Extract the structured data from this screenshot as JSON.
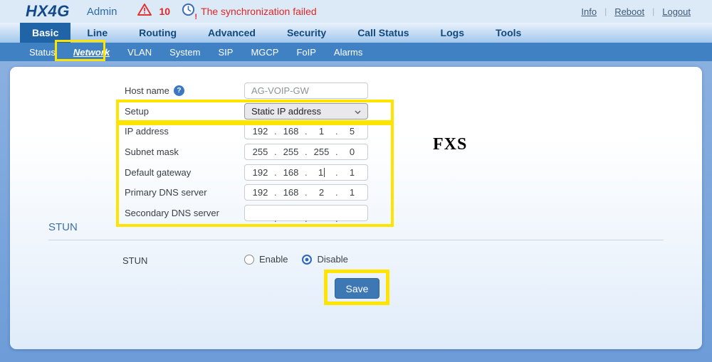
{
  "header": {
    "brand": "HX4G",
    "user": "Admin",
    "alert_count": "10",
    "alert_message": "The synchronization failed",
    "links": [
      {
        "label": "Info"
      },
      {
        "label": "Reboot"
      },
      {
        "label": "Logout"
      }
    ],
    "icons": {
      "warning": "warning-triangle",
      "sync": "sync-failed-clock"
    },
    "alert_color": "#e02626"
  },
  "nav": {
    "tabs": [
      {
        "label": "Basic",
        "active": true
      },
      {
        "label": "Line",
        "active": false
      },
      {
        "label": "Routing",
        "active": false
      },
      {
        "label": "Advanced",
        "active": false
      },
      {
        "label": "Security",
        "active": false
      },
      {
        "label": "Call Status",
        "active": false
      },
      {
        "label": "Logs",
        "active": false
      },
      {
        "label": "Tools",
        "active": false
      }
    ],
    "subtabs": [
      {
        "label": "Status",
        "active": false
      },
      {
        "label": "Network",
        "active": true
      },
      {
        "label": "VLAN",
        "active": false
      },
      {
        "label": "System",
        "active": false
      },
      {
        "label": "SIP",
        "active": false
      },
      {
        "label": "MGCP",
        "active": false
      },
      {
        "label": "FoIP",
        "active": false
      },
      {
        "label": "Alarms",
        "active": false
      }
    ],
    "active_tab_color": "#1e64a7",
    "subnav_color": "#3f81c2"
  },
  "form": {
    "host": {
      "label": "Host name",
      "value": "AG-VOIP-GW",
      "help_icon": "question-circle"
    },
    "setup": {
      "label": "Setup",
      "value": "Static IP address"
    },
    "ip_rows": [
      {
        "label": "IP address",
        "octets": [
          "192",
          "168",
          "1",
          "5"
        ]
      },
      {
        "label": "Subnet mask",
        "octets": [
          "255",
          "255",
          "255",
          "0"
        ]
      },
      {
        "label": "Default gateway",
        "octets": [
          "192",
          "168",
          "1",
          "1"
        ]
      },
      {
        "label": "Primary DNS server",
        "octets": [
          "192",
          "168",
          "2",
          "1"
        ]
      },
      {
        "label": "Secondary DNS server",
        "octets": [
          "",
          "",
          "",
          ""
        ]
      }
    ]
  },
  "annotation": {
    "fxs_label": "FXS",
    "highlight_color": "#ffe400"
  },
  "stun": {
    "section_title": "STUN",
    "label": "STUN",
    "options": [
      {
        "label": "Enable"
      },
      {
        "label": "Disable"
      }
    ],
    "selected": "Disable"
  },
  "save_label": "Save"
}
